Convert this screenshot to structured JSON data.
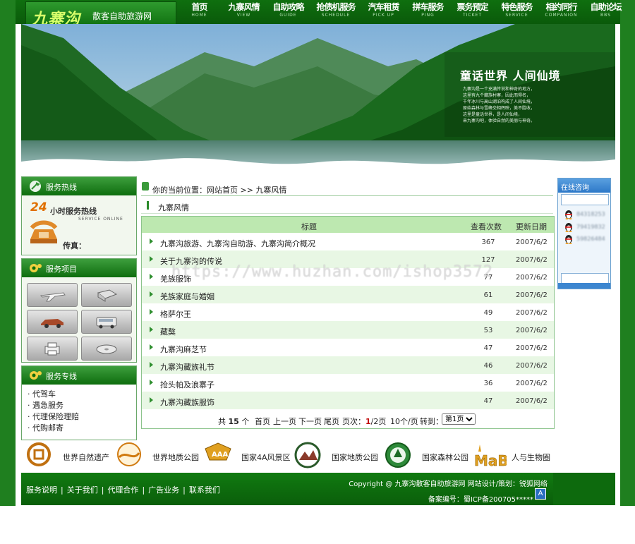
{
  "brand": {
    "logo_text": "九寨沟",
    "subtitle": "散客自助旅游网"
  },
  "nav": [
    {
      "cn": "首页",
      "en": "HOME"
    },
    {
      "cn": "九寨风情",
      "en": "VIEW"
    },
    {
      "cn": "自助攻略",
      "en": "GUIDE"
    },
    {
      "cn": "抢债机服务",
      "en": "SCHEDULE"
    },
    {
      "cn": "汽车租赁",
      "en": "PICK UP"
    },
    {
      "cn": "拼车服务",
      "en": "PING"
    },
    {
      "cn": "票务预定",
      "en": "TICKET"
    },
    {
      "cn": "特色服务",
      "en": "SERVICE"
    },
    {
      "cn": "相约同行",
      "en": "COMPANION"
    },
    {
      "cn": "自助论坛",
      "en": "BBS"
    }
  ],
  "banner": {
    "title": "童话世界  人间仙境",
    "text_lines": [
      "九寨沟是一个充满传说和神奇的地方，",
      "这里有九个藏族村寨，因此而得名，",
      "千年冰川与高山湖泊构成了人间仙境，",
      "原始森林与雪峰交相辉映，美不胜收，",
      "这里是童话世界，是人间仙境，",
      "来九寨沟吧，体验自然的美丽与神奇。"
    ]
  },
  "hotline": {
    "title": "服务热线",
    "number_24": "24",
    "text": "小时服务热线",
    "en": "SERVICE ONLINE",
    "fax_label": "传真："
  },
  "services": {
    "title": "服务项目"
  },
  "special": {
    "title": "服务专线",
    "items": [
      "· 代驾车",
      "· 遇急服务",
      "· 代理保险理赔",
      "· 代购邮寄"
    ]
  },
  "breadcrumb": {
    "label": "你的当前位置：",
    "home": "网站首页",
    "sep": ">>",
    "current": "九寨风情"
  },
  "section": {
    "title": "九寨风情"
  },
  "table": {
    "headers": {
      "title": "标题",
      "views": "查看次数",
      "date": "更新日期"
    },
    "rows": [
      {
        "title": "九寨沟旅游、九寨沟自助游、九寨沟简介概况",
        "views": "367",
        "date": "2007/6/2"
      },
      {
        "title": "关于九寨沟的传说",
        "views": "127",
        "date": "2007/6/2"
      },
      {
        "title": "羌族服饰",
        "views": "77",
        "date": "2007/6/2"
      },
      {
        "title": "羌族家庭与婚姻",
        "views": "61",
        "date": "2007/6/2"
      },
      {
        "title": "格萨尔王",
        "views": "49",
        "date": "2007/6/2"
      },
      {
        "title": "藏獒",
        "views": "53",
        "date": "2007/6/2"
      },
      {
        "title": "九寨沟麻芝节",
        "views": "47",
        "date": "2007/6/2"
      },
      {
        "title": "九寨沟藏族礼节",
        "views": "46",
        "date": "2007/6/2"
      },
      {
        "title": "抢头帕及浪寨子",
        "views": "36",
        "date": "2007/6/2"
      },
      {
        "title": "九寨沟藏族服饰",
        "views": "47",
        "date": "2007/6/2"
      }
    ]
  },
  "pager": {
    "total_prefix": "共",
    "total": "15",
    "total_suffix": "个",
    "first": "首页",
    "prev": "上一页",
    "next": "下一页",
    "last": "尾页",
    "page_label": "页次：",
    "page_current": "1",
    "page_total": "/2页",
    "per_page": "10个/页",
    "goto": "转到：",
    "select_value": "第1页"
  },
  "online": {
    "title": "在线咨询",
    "qq": [
      "84318253",
      "79419832",
      "59826484"
    ]
  },
  "heritage": [
    "世界自然遗产",
    "世界地质公园",
    "国家4A风景区",
    "国家地质公园",
    "国家森林公园",
    "人与生物圈"
  ],
  "footer": {
    "links": [
      "服务说明",
      "关于我们",
      "代理合作",
      "广告业务",
      "联系我们"
    ],
    "copyright": "Copyright @ 九寨沟散客自助旅游网 网站设计/策划：锐狐网络",
    "icp": "备案编号：蜀ICP备200705*****"
  },
  "watermark": "https://www.huzhan.com/ishop3572",
  "colors": {
    "primary_green": "#1f7f1f",
    "dark_green": "#0a5e0a",
    "row_alt": "#e8f7e4",
    "header_row": "#bde8b0",
    "accent_orange": "#e07000",
    "page_red": "#c00000"
  }
}
